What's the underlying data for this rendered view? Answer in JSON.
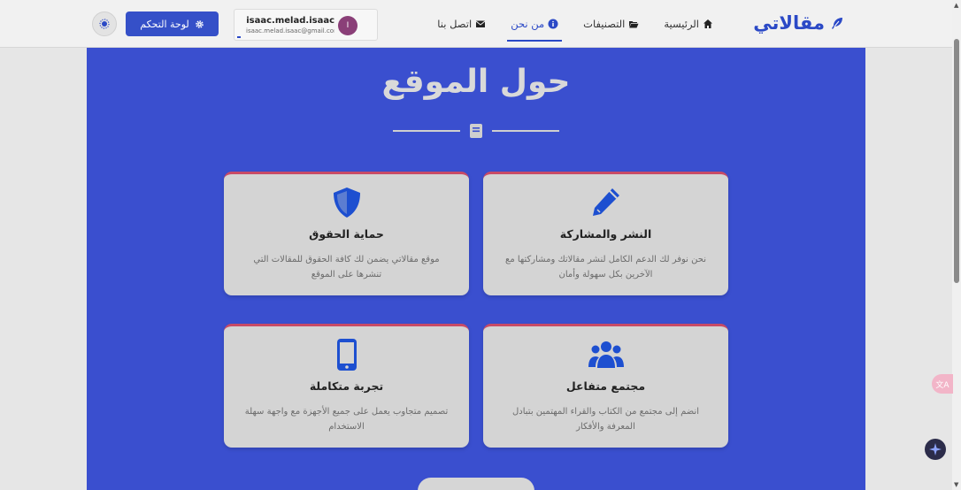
{
  "brand": {
    "name": "مقالاتي"
  },
  "nav": {
    "home": "الرئيسية",
    "categories": "التصنيفات",
    "about": "من نحن",
    "contact": "اتصل بنا"
  },
  "user": {
    "initial": "I",
    "name": "isaac.melad.isaac",
    "email": "isaac.melad.isaac@gmail.com"
  },
  "header_actions": {
    "dashboard": "لوحة التحكم"
  },
  "hero": {
    "title": "حول الموقع"
  },
  "cards": [
    {
      "title": "النشر والمشاركة",
      "desc": "نحن نوفر لك الدعم الكامل لنشر مقالاتك ومشاركتها مع الآخرين بكل سهولة وأمان",
      "icon": "pencil-icon"
    },
    {
      "title": "حماية الحقوق",
      "desc": "موقع مقالاتي يضمن لك كافة الحقوق للمقالات التي تنشرها على الموقع",
      "icon": "shield-icon"
    },
    {
      "title": "مجتمع متفاعل",
      "desc": "انضم إلى مجتمع من الكتاب والقراء المهتمين بتبادل المعرفة والأفكار",
      "icon": "users-icon"
    },
    {
      "title": "تجربة متكاملة",
      "desc": "تصميم متجاوب يعمل على جميع الأجهزة مع واجهة سهلة الاستخدام",
      "icon": "mobile-icon"
    }
  ],
  "widgets": {
    "translate": "文A"
  },
  "colors": {
    "primary": "#2b49c6",
    "hero_bg": "#3a4fcf",
    "card_accent": "#c84a66",
    "icon_blue": "#1d4fd0"
  }
}
